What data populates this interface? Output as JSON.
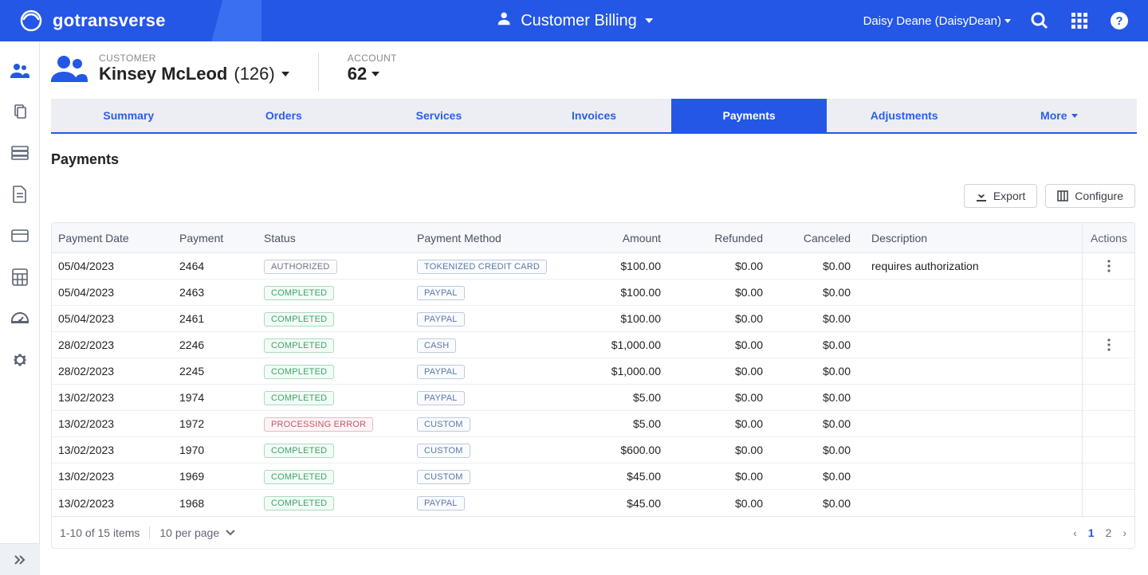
{
  "app": {
    "brand": "gotransverse",
    "module": "Customer Billing"
  },
  "user": {
    "display": "Daisy Deane (DaisyDean)"
  },
  "customer": {
    "label": "CUSTOMER",
    "name": "Kinsey McLeod",
    "number": "(126)"
  },
  "account": {
    "label": "ACCOUNT",
    "value": "62"
  },
  "tabs": {
    "items": [
      "Summary",
      "Orders",
      "Services",
      "Invoices",
      "Payments",
      "Adjustments",
      "More"
    ],
    "active": 4
  },
  "section": {
    "title": "Payments"
  },
  "buttons": {
    "export": "Export",
    "configure": "Configure"
  },
  "table": {
    "headers": {
      "date": "Payment Date",
      "payment": "Payment",
      "status": "Status",
      "method": "Payment Method",
      "amount": "Amount",
      "refunded": "Refunded",
      "canceled": "Canceled",
      "description": "Description",
      "actions": "Actions"
    },
    "rows": [
      {
        "date": "05/04/2023",
        "payment": "2464",
        "status": "AUTHORIZED",
        "status_kind": "gray",
        "method": "TOKENIZED CREDIT CARD",
        "amount": "$100.00",
        "refunded": "$0.00",
        "canceled": "$0.00",
        "description": "requires authorization",
        "actions": true
      },
      {
        "date": "05/04/2023",
        "payment": "2463",
        "status": "COMPLETED",
        "status_kind": "green",
        "method": "PAYPAL",
        "amount": "$100.00",
        "refunded": "$0.00",
        "canceled": "$0.00",
        "description": "",
        "actions": false
      },
      {
        "date": "05/04/2023",
        "payment": "2461",
        "status": "COMPLETED",
        "status_kind": "green",
        "method": "PAYPAL",
        "amount": "$100.00",
        "refunded": "$0.00",
        "canceled": "$0.00",
        "description": "",
        "actions": false
      },
      {
        "date": "28/02/2023",
        "payment": "2246",
        "status": "COMPLETED",
        "status_kind": "green",
        "method": "CASH",
        "amount": "$1,000.00",
        "refunded": "$0.00",
        "canceled": "$0.00",
        "description": "",
        "actions": true
      },
      {
        "date": "28/02/2023",
        "payment": "2245",
        "status": "COMPLETED",
        "status_kind": "green",
        "method": "PAYPAL",
        "amount": "$1,000.00",
        "refunded": "$0.00",
        "canceled": "$0.00",
        "description": "",
        "actions": false
      },
      {
        "date": "13/02/2023",
        "payment": "1974",
        "status": "COMPLETED",
        "status_kind": "green",
        "method": "PAYPAL",
        "amount": "$5.00",
        "refunded": "$0.00",
        "canceled": "$0.00",
        "description": "",
        "actions": false
      },
      {
        "date": "13/02/2023",
        "payment": "1972",
        "status": "PROCESSING ERROR",
        "status_kind": "red",
        "method": "CUSTOM",
        "amount": "$5.00",
        "refunded": "$0.00",
        "canceled": "$0.00",
        "description": "",
        "actions": false
      },
      {
        "date": "13/02/2023",
        "payment": "1970",
        "status": "COMPLETED",
        "status_kind": "green",
        "method": "CUSTOM",
        "amount": "$600.00",
        "refunded": "$0.00",
        "canceled": "$0.00",
        "description": "",
        "actions": false
      },
      {
        "date": "13/02/2023",
        "payment": "1969",
        "status": "COMPLETED",
        "status_kind": "green",
        "method": "CUSTOM",
        "amount": "$45.00",
        "refunded": "$0.00",
        "canceled": "$0.00",
        "description": "",
        "actions": false
      },
      {
        "date": "13/02/2023",
        "payment": "1968",
        "status": "COMPLETED",
        "status_kind": "green",
        "method": "PAYPAL",
        "amount": "$45.00",
        "refunded": "$0.00",
        "canceled": "$0.00",
        "description": "",
        "actions": false
      }
    ],
    "footer": {
      "range": "1-10 of 15 items",
      "per_page": "10 per page",
      "pages": [
        "1",
        "2"
      ],
      "current_page": 0
    }
  }
}
